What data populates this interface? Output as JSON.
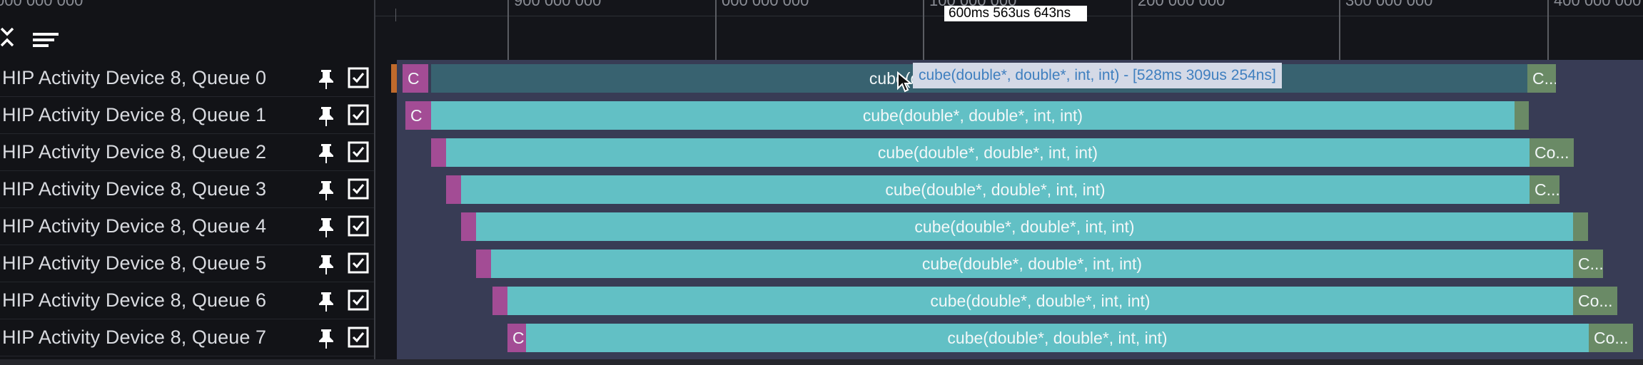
{
  "left_ruler": {
    "label": "000 000 000"
  },
  "toolbar": {
    "collapse_icon": "collapse-all-icon",
    "filter_icon": "sort-lines-icon"
  },
  "tracks": [
    {
      "label": "HIP Activity Device 8, Queue 0"
    },
    {
      "label": "HIP Activity Device 8, Queue 1"
    },
    {
      "label": "HIP Activity Device 8, Queue 2"
    },
    {
      "label": "HIP Activity Device 8, Queue 3"
    },
    {
      "label": "HIP Activity Device 8, Queue 4"
    },
    {
      "label": "HIP Activity Device 8, Queue 5"
    },
    {
      "label": "HIP Activity Device 8, Queue 6"
    },
    {
      "label": "HIP Activity Device 8, Queue 7"
    }
  ],
  "ruler": {
    "ticks": [
      "900 000 000",
      "000 000 000",
      "100 000 000",
      "200 000 000",
      "300 000 000",
      "400 000 000"
    ],
    "cursor_time": "600ms 563us 643ns"
  },
  "slices": {
    "q0": {
      "copy": "C",
      "kernel": "cube(double*, double*, int, int)",
      "tail": "C..."
    },
    "q1": {
      "copy": "C",
      "kernel": "cube(double*, double*, int, int)",
      "tail": ""
    },
    "q2": {
      "copy": "",
      "kernel": "cube(double*, double*, int, int)",
      "tail": "Co..."
    },
    "q3": {
      "copy": "",
      "kernel": "cube(double*, double*, int, int)",
      "tail": "C..."
    },
    "q4": {
      "copy": "",
      "kernel": "cube(double*, double*, int, int)",
      "tail": ""
    },
    "q5": {
      "copy": "",
      "kernel": "cube(double*, double*, int, int)",
      "tail": "C..."
    },
    "q6": {
      "copy": "",
      "kernel": "cube(double*, double*, int, int)",
      "tail": "Co..."
    },
    "q7": {
      "copy": "C",
      "kernel": "cube(double*, double*, int, int)",
      "tail": "Co..."
    }
  },
  "tooltip": {
    "text": "cube(double*, double*, int, int) - [528ms 309us 254ns]"
  },
  "colors": {
    "copy": "#a34c95",
    "kernel": "#62c0c5",
    "kernel_hover": "#386270",
    "tail": "#6a8a66",
    "track_bg": "#383c55"
  }
}
